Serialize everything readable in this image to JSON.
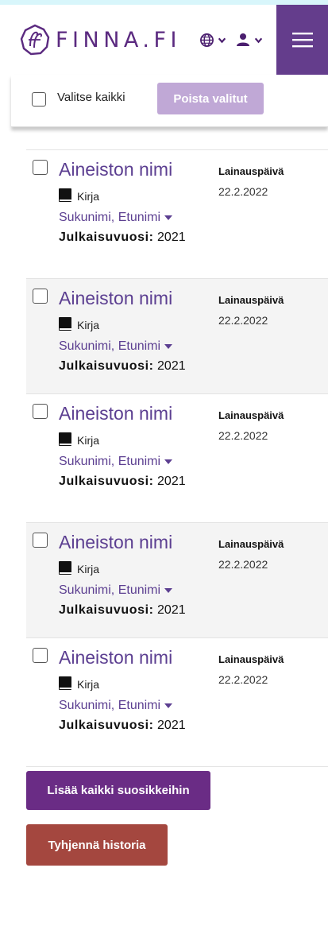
{
  "header": {
    "logo_text": "FINNA.FI",
    "language_icon": "globe-icon",
    "user_icon": "user-icon",
    "menu_icon": "hamburger-menu-icon"
  },
  "toolbar": {
    "select_all_label": "Valitse kaikki",
    "remove_selected_label": "Poista valitut"
  },
  "items": [
    {
      "title": "Aineiston nimi",
      "format": "Kirja",
      "author": "Sukunimi, Etunimi",
      "year_label": "Julkaisuvuosi:",
      "year": "2021",
      "loan_label": "Lainauspäivä",
      "loan_date": "22.2.2022"
    },
    {
      "title": "Aineiston nimi",
      "format": "Kirja",
      "author": "Sukunimi, Etunimi",
      "year_label": "Julkaisuvuosi:",
      "year": "2021",
      "loan_label": "Lainauspäivä",
      "loan_date": "22.2.2022"
    },
    {
      "title": "Aineiston nimi",
      "format": "Kirja",
      "author": "Sukunimi, Etunimi",
      "year_label": "Julkaisuvuosi:",
      "year": "2021",
      "loan_label": "Lainauspäivä",
      "loan_date": "22.2.2022"
    },
    {
      "title": "Aineiston nimi",
      "format": "Kirja",
      "author": "Sukunimi, Etunimi",
      "year_label": "Julkaisuvuosi:",
      "year": "2021",
      "loan_label": "Lainauspäivä",
      "loan_date": "22.2.2022"
    },
    {
      "title": "Aineiston nimi",
      "format": "Kirja",
      "author": "Sukunimi, Etunimi",
      "year_label": "Julkaisuvuosi:",
      "year": "2021",
      "loan_label": "Lainauspäivä",
      "loan_date": "22.2.2022"
    }
  ],
  "actions": {
    "add_all_favorites_label": "Lisää kaikki suosikkeihin",
    "clear_history_label": "Tyhjennä historia"
  },
  "colors": {
    "brand_purple": "#643d8c",
    "link_purple": "#5c3f91",
    "disabled_button": "#c0a8d6",
    "favorites_button": "#6a2c85",
    "clear_button": "#a4473f",
    "top_strip": "#d8f6fb"
  }
}
